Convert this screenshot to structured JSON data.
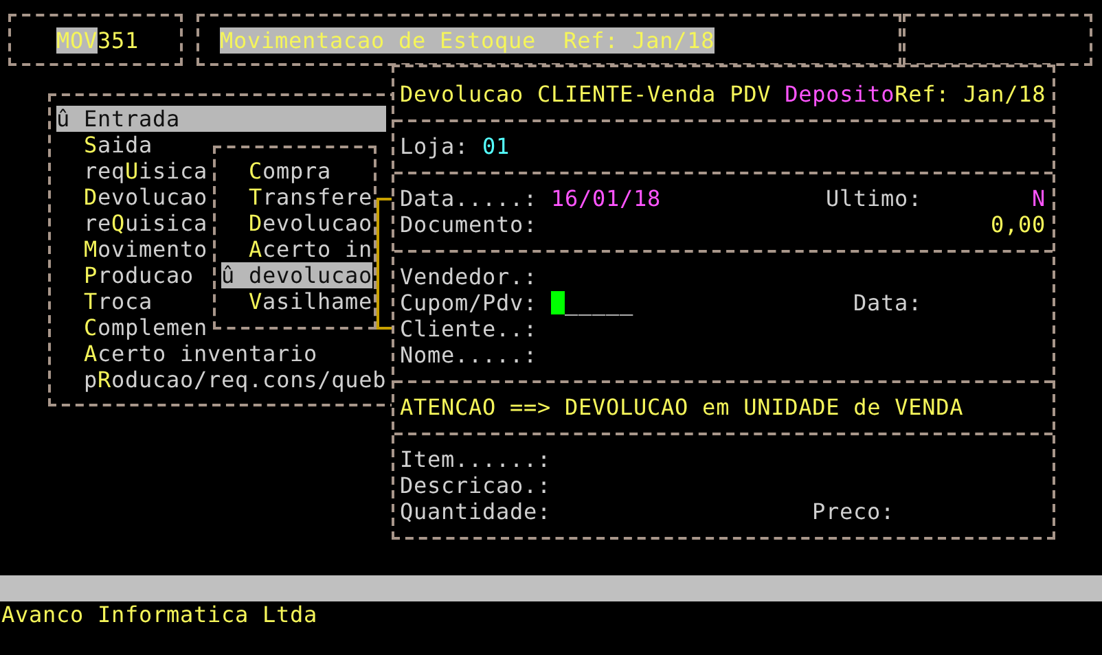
{
  "header": {
    "code": [
      {
        "text": "MOV",
        "highlighted": true
      },
      {
        "text": "351",
        "highlighted": false
      }
    ],
    "title": "Movimentacao de Estoque  Ref: Jan/18"
  },
  "menu": {
    "items": [
      {
        "marker": "û",
        "key": "E",
        "suffix": "ntrada",
        "selected": true
      },
      {
        "key": "S",
        "suffix": "aida",
        "selected": false
      },
      {
        "prefix": "req",
        "key": "U",
        "suffix": "isica",
        "selected": false
      },
      {
        "key": "D",
        "suffix": "evolucao",
        "selected": false
      },
      {
        "prefix": "re",
        "key": "Q",
        "suffix": "uisica",
        "selected": false
      },
      {
        "key": "M",
        "suffix": "ovimento",
        "selected": false
      },
      {
        "key": "P",
        "suffix": "roducao",
        "selected": false
      },
      {
        "key": "T",
        "suffix": "roca",
        "selected": false
      },
      {
        "key": "C",
        "suffix": "omplemen",
        "selected": false
      },
      {
        "key": "A",
        "suffix": "certo inventario",
        "selected": false
      },
      {
        "prefix": "p",
        "key": "R",
        "suffix": "oducao/req.cons/queb",
        "selected": false
      }
    ]
  },
  "submenu": {
    "items": [
      {
        "key": "C",
        "suffix": "ompra",
        "selected": false
      },
      {
        "key": "T",
        "suffix": "ransfere",
        "selected": false
      },
      {
        "key": "D",
        "suffix": "evolucao",
        "selected": false
      },
      {
        "key": "A",
        "suffix": "certo in",
        "selected": false
      },
      {
        "marker": "û",
        "key": "d",
        "suffix": "evolucao",
        "selected": true
      },
      {
        "key": "V",
        "suffix": "asilhame",
        "selected": false
      }
    ]
  },
  "dialog": {
    "title": [
      {
        "text": "Devolucao CLIENTE-Venda PDV ",
        "color": "#f5f55a"
      },
      {
        "text": "Deposito",
        "color": "#ff55ff"
      },
      {
        "text": "Ref: Jan/18",
        "color": "#f5f55a"
      }
    ],
    "sections": [
      {
        "kind": "fields",
        "lines": [
          {
            "label": "Loja:",
            "value": {
              "text": "01",
              "color": "#55ffff"
            }
          }
        ]
      },
      {
        "kind": "fields",
        "lines": [
          {
            "label": "Data.....:",
            "value": {
              "text": "16/01/18",
              "color": "#ff55ff"
            },
            "side_label": "Ultimo:",
            "side_value": {
              "text": "N",
              "color": "#ff55ff"
            }
          },
          {
            "label": "Documento:",
            "side_value": {
              "text": "0,00",
              "color": "#f5f55a"
            }
          }
        ]
      },
      {
        "kind": "fields",
        "lines": [
          {
            "label": "Vendedor.:"
          },
          {
            "label": "Cupom/Pdv:",
            "input": {
              "mask": "_____",
              "focused": true
            },
            "side_label": "Data:"
          },
          {
            "label": "Cliente..:"
          },
          {
            "label": "Nome.....:"
          }
        ]
      },
      {
        "kind": "notice",
        "text": "ATENCAO ==> DEVOLUCAO em UNIDADE de VENDA"
      },
      {
        "kind": "fields",
        "lines": [
          {
            "label": "Item......:"
          },
          {
            "label": "Descricao.:"
          },
          {
            "label": "Quantidade:",
            "side_label": "Preco:"
          }
        ]
      }
    ]
  },
  "footer": "Avanco Informatica Ltda"
}
